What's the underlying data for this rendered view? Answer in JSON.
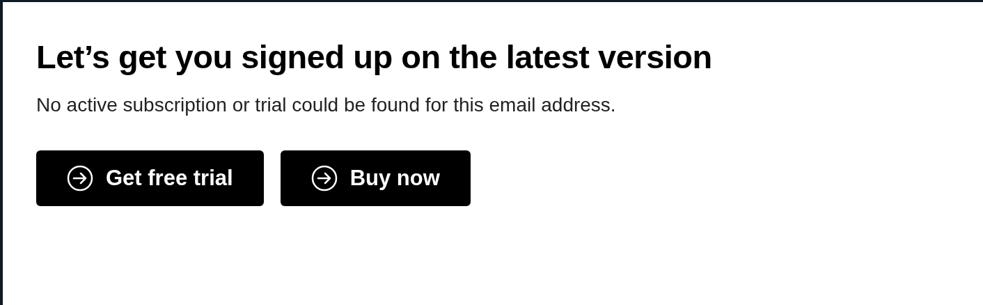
{
  "heading": "Let’s get you signed up on the latest version",
  "message": "No active subscription or trial could be found for this email address.",
  "buttons": [
    {
      "label": "Get free trial"
    },
    {
      "label": "Buy now"
    }
  ]
}
